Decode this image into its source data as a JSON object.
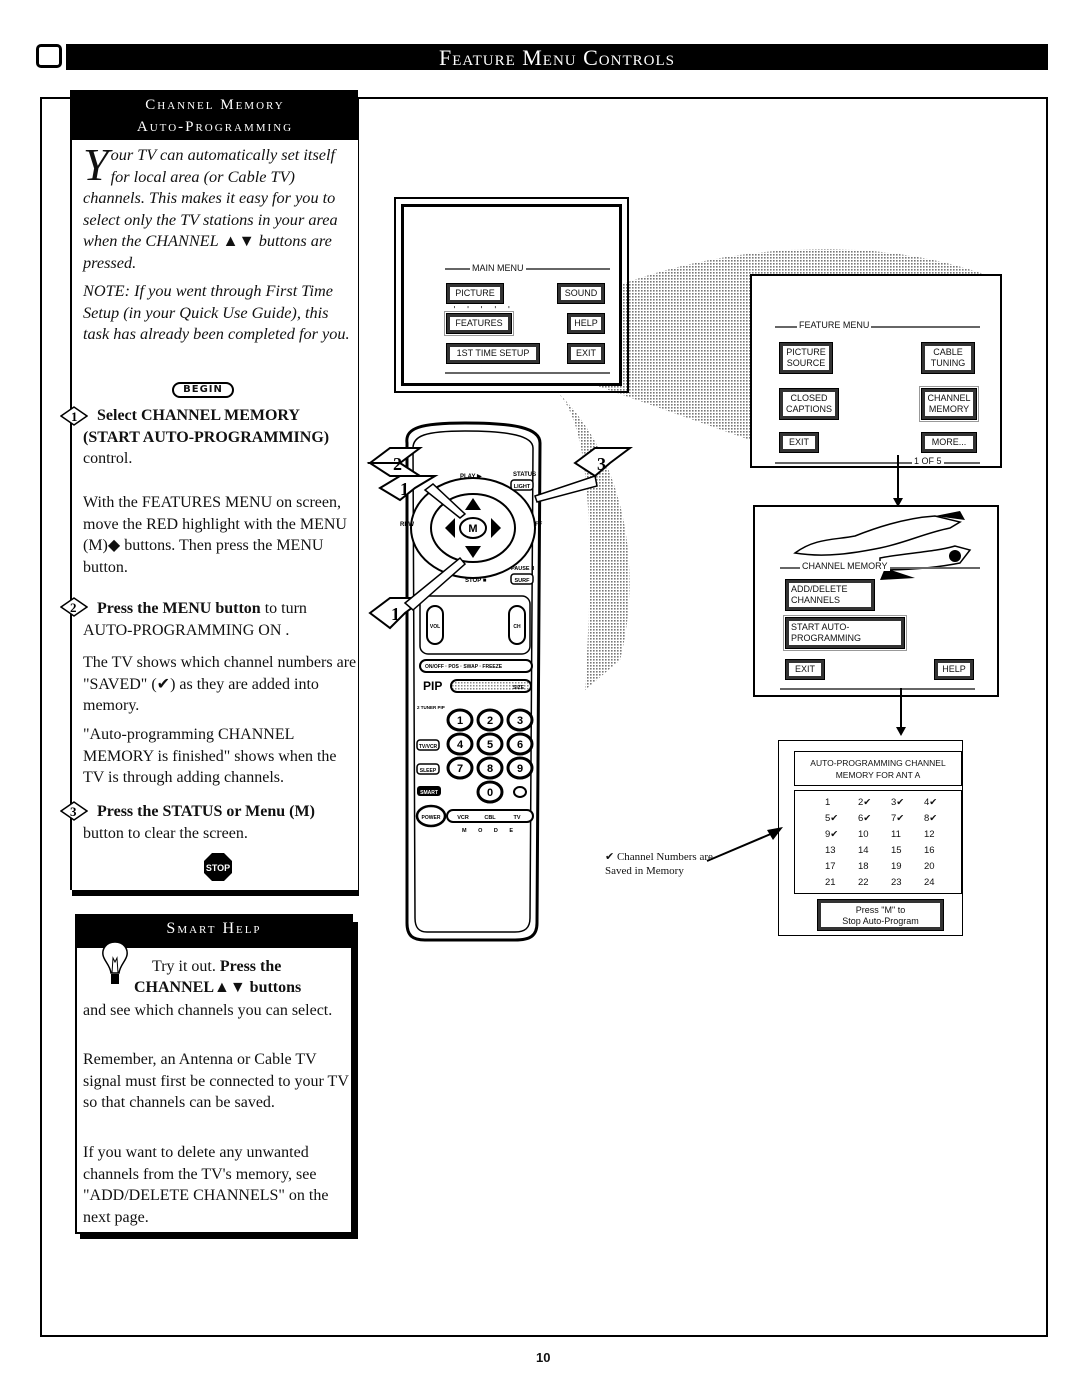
{
  "header": {
    "title": "Feature Menu Controls",
    "tv_icon": "tv-screen-icon"
  },
  "channel_memory_panel": {
    "title_line1": "Channel Memory",
    "title_line2": "Auto-Programming",
    "intro_dropcap": "Y",
    "intro_text": "our TV can automatically set itself for local area (or Cable TV) channels. This makes it easy for you to select only the TV stations in your area when the CHANNEL ▲▼ buttons are pressed.",
    "note": "NOTE: If you went through First Time Setup (in your Quick Use Guide), this task has already been completed for you.",
    "begin_label": "BEGIN",
    "steps": [
      {
        "number": "1",
        "bold": "Select CHANNEL MEMORY (START AUTO-PROGRAMMING)",
        "text": " control."
      },
      {
        "number": "2",
        "bold": "Press the MENU button",
        "text": " to turn AUTO-PROGRAMMING ON ."
      },
      {
        "number": "3",
        "bold": "Press the STATUS or Menu (M)",
        "text": " button to clear the screen."
      }
    ],
    "step1_detail": "With the FEATURES MENU on screen, move the RED highlight  with the MENU (M)◆ buttons. Then press the MENU button.",
    "step2_detail_1": "The TV shows which channel numbers are \"SAVED\" (✔) as they are added into memory.",
    "step2_detail_2": "\"Auto-programming CHANNEL MEMORY is finished\" shows when the TV is through adding channels.",
    "stop_label": "STOP"
  },
  "smart_help": {
    "title": "Smart Help",
    "line1_plain": "Try it out.",
    "line1_bold": "Press the",
    "line2_bold": "CHANNEL▲▼ buttons",
    "para1": "and see which channels you can select.",
    "para2": "Remember, an Antenna or Cable TV signal must first be connected to your TV so that channels can be saved.",
    "para3": "If you want to delete any unwanted channels from the TV's memory, see \"ADD/DELETE CHANNELS\" on the next page."
  },
  "main_menu": {
    "title": "MAIN MENU",
    "buttons": [
      "PICTURE",
      "SOUND",
      "FEATURES",
      "HELP",
      "1ST TIME SETUP",
      "EXIT"
    ],
    "highlighted": "FEATURES"
  },
  "feature_menu": {
    "title": "FEATURE MENU",
    "buttons": [
      "PICTURE SOURCE",
      "CABLE TUNING",
      "CLOSED CAPTIONS",
      "CHANNEL MEMORY",
      "EXIT",
      "MORE..."
    ],
    "highlighted": "CHANNEL MEMORY",
    "page_indicator": "1 OF 5"
  },
  "channel_memory_menu": {
    "title": "CHANNEL MEMORY",
    "buttons": [
      "ADD/DELETE CHANNELS",
      "START AUTO-PROGRAMMING",
      "EXIT",
      "HELP"
    ],
    "highlighted": "START AUTO-PROGRAMMING"
  },
  "auto_programming": {
    "header": "AUTO-PROGRAMMING CHANNEL MEMORY FOR ANT A",
    "channels": [
      {
        "n": "1",
        "saved": false
      },
      {
        "n": "2",
        "saved": true
      },
      {
        "n": "3",
        "saved": true
      },
      {
        "n": "4",
        "saved": true
      },
      {
        "n": "5",
        "saved": true
      },
      {
        "n": "6",
        "saved": true
      },
      {
        "n": "7",
        "saved": true
      },
      {
        "n": "8",
        "saved": true
      },
      {
        "n": "9",
        "saved": true
      },
      {
        "n": "10",
        "saved": false
      },
      {
        "n": "11",
        "saved": false
      },
      {
        "n": "12",
        "saved": false
      },
      {
        "n": "13",
        "saved": false
      },
      {
        "n": "14",
        "saved": false
      },
      {
        "n": "15",
        "saved": false
      },
      {
        "n": "16",
        "saved": false
      },
      {
        "n": "17",
        "saved": false
      },
      {
        "n": "18",
        "saved": false
      },
      {
        "n": "19",
        "saved": false
      },
      {
        "n": "20",
        "saved": false
      },
      {
        "n": "21",
        "saved": false
      },
      {
        "n": "22",
        "saved": false
      },
      {
        "n": "23",
        "saved": false
      },
      {
        "n": "24",
        "saved": false
      }
    ],
    "check_glyph": "✔",
    "press_line1": "Press \"M\" to",
    "press_line2": "Stop Auto-Program",
    "legend_line1": "✔ Channel Numbers are",
    "legend_line2": "Saved in Memory"
  },
  "remote": {
    "labels": [
      "PLAY ▶",
      "STATUS",
      "LIGHT",
      "REW",
      "FF",
      "M",
      "PAUSE II",
      "SURF",
      "STOP ■",
      "VOL",
      "CH",
      "ON/OFF",
      "POS",
      "SWAP",
      "FREEZE",
      "PIP",
      "SIZE",
      "2 TUNER PIP",
      "TV/VCR",
      "SLEEP",
      "SMART",
      "POWER",
      "VCR",
      "CBL",
      "TV",
      "M O D E"
    ],
    "digits": [
      "1",
      "2",
      "3",
      "4",
      "5",
      "6",
      "7",
      "8",
      "9",
      "0"
    ],
    "callouts": [
      "2",
      "1",
      "3",
      "1"
    ]
  },
  "page_number": "10"
}
